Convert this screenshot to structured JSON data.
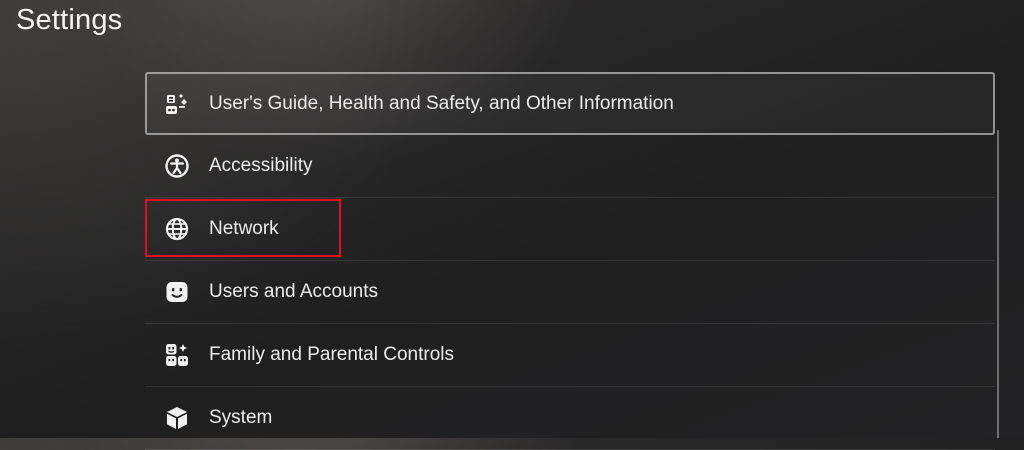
{
  "header": {
    "title": "Settings"
  },
  "settings": {
    "items": [
      {
        "label": "User's Guide, Health and Safety, and Other Information",
        "icon": "guide-icon",
        "selected": true
      },
      {
        "label": "Accessibility",
        "icon": "accessibility-icon",
        "selected": false
      },
      {
        "label": "Network",
        "icon": "globe-icon",
        "selected": false,
        "highlighted": true
      },
      {
        "label": "Users and Accounts",
        "icon": "user-face-icon",
        "selected": false
      },
      {
        "label": "Family and Parental Controls",
        "icon": "family-icon",
        "selected": false
      },
      {
        "label": "System",
        "icon": "cube-icon",
        "selected": false
      }
    ]
  },
  "colors": {
    "highlight": "#e0111b",
    "text": "#ececec"
  }
}
